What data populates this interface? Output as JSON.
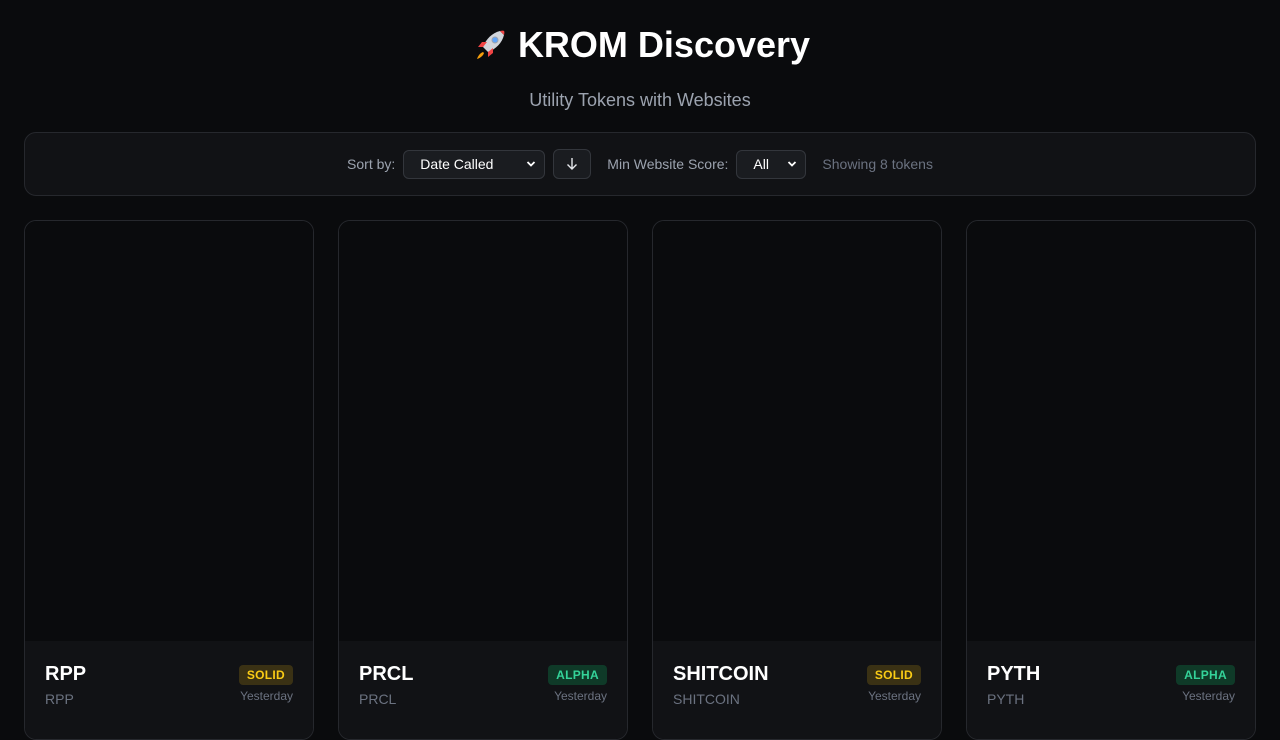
{
  "header": {
    "title": "KROM Discovery",
    "subtitle": "Utility Tokens with Websites"
  },
  "controls": {
    "sort_label": "Sort by:",
    "sort_value": "Date Called",
    "sort_direction_icon": "arrow-down-icon",
    "score_label": "Min Website Score:",
    "score_value": "All",
    "count_text": "Showing 8 tokens"
  },
  "tokens": [
    {
      "name": "RPP",
      "symbol": "RPP",
      "badge": "SOLID",
      "date": "Yesterday"
    },
    {
      "name": "PRCL",
      "symbol": "PRCL",
      "badge": "ALPHA",
      "date": "Yesterday"
    },
    {
      "name": "SHITCOIN",
      "symbol": "SHITCOIN",
      "badge": "SOLID",
      "date": "Yesterday"
    },
    {
      "name": "PYTH",
      "symbol": "PYTH",
      "badge": "ALPHA",
      "date": "Yesterday"
    }
  ],
  "colors": {
    "background": "#0a0b0d",
    "solid_badge": "#facc15",
    "alpha_badge": "#34d399"
  }
}
